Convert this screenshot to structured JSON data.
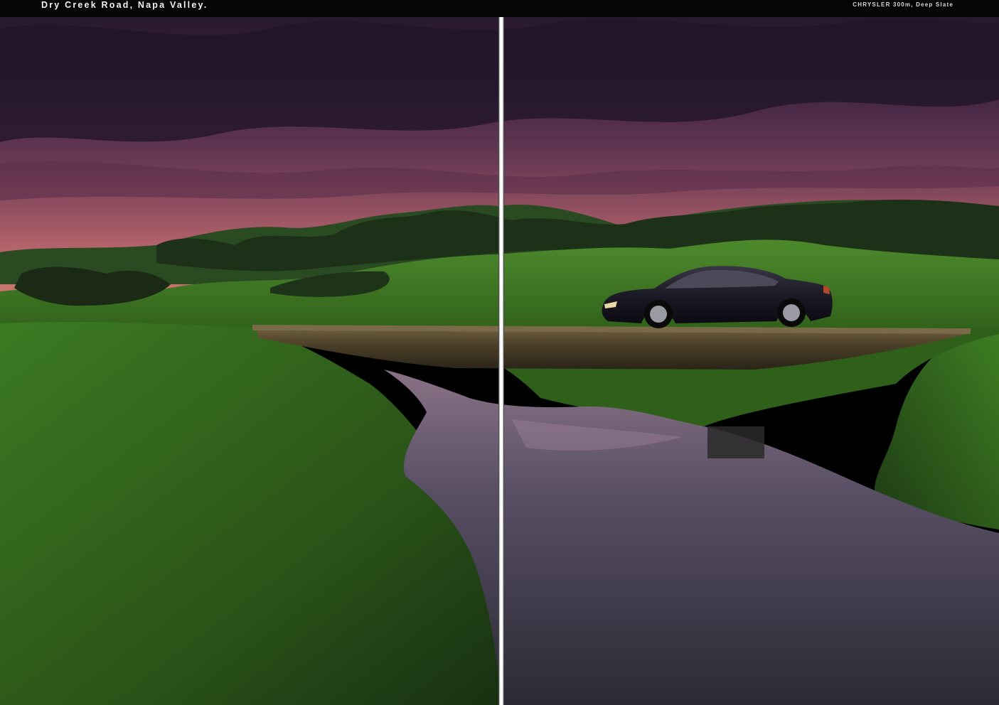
{
  "caption": {
    "location": "Dry Creek Road, Napa Valley.",
    "vehicle": "CHRYSLER 300m, Deep Slate"
  },
  "scene": {
    "subject": "car-on-bridge",
    "car_color": "#1c1a26",
    "sky_colors": [
      "#2a1a30",
      "#4a2a4a",
      "#c06a6a"
    ],
    "grass_color": "#3e7a1e",
    "water_color": "#4a4a58"
  }
}
